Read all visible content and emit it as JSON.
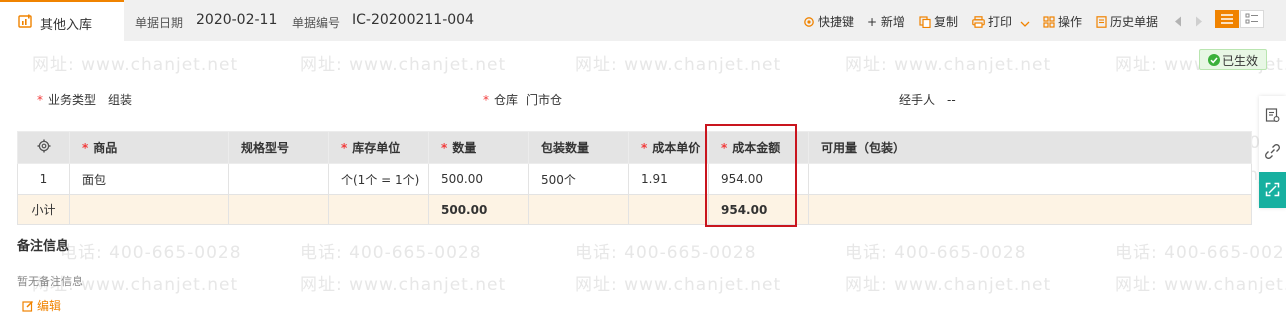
{
  "header": {
    "tab_title": "其他入库",
    "date_label": "单据日期",
    "date_value": "2020-02-11",
    "code_label": "单据编号",
    "code_value": "IC-20200211-004"
  },
  "toolbar": {
    "shortcut": "快捷键",
    "add": "+ 新增",
    "copy": "复制",
    "print": "打印",
    "operate": "操作",
    "history": "历史单据"
  },
  "status": {
    "label": "已生效",
    "color": "#3bb03b"
  },
  "fields": {
    "biz_type_label": "业务类型",
    "biz_type_value": "组装",
    "warehouse_label": "仓库",
    "warehouse_value": "门市仓",
    "handler_label": "经手人",
    "handler_value": "--"
  },
  "grid": {
    "headers": [
      "商品",
      "规格型号",
      "库存单位",
      "数量",
      "包装数量",
      "成本单价",
      "成本金额",
      "可用量（包装）"
    ],
    "required_mark": "*",
    "rows": [
      {
        "no": "1",
        "product": "面包",
        "spec": "",
        "unit": "个(1个 = 1个)",
        "qty": "500.00",
        "pack_qty": "500个",
        "unit_cost": "1.91",
        "amount": "954.00",
        "available": ""
      }
    ],
    "subtotal": {
      "label": "小计",
      "qty": "500.00",
      "amount": "954.00"
    }
  },
  "remark": {
    "title": "备注信息",
    "empty": "暂无备注信息",
    "edit": "编辑"
  },
  "watermark": {
    "phone": "电话: 400-665-0028",
    "site": "网址: www.chanjet.net"
  },
  "colors": {
    "accent": "#f08300",
    "highlight": "#c9151e",
    "rail_active": "#17b0a0"
  }
}
